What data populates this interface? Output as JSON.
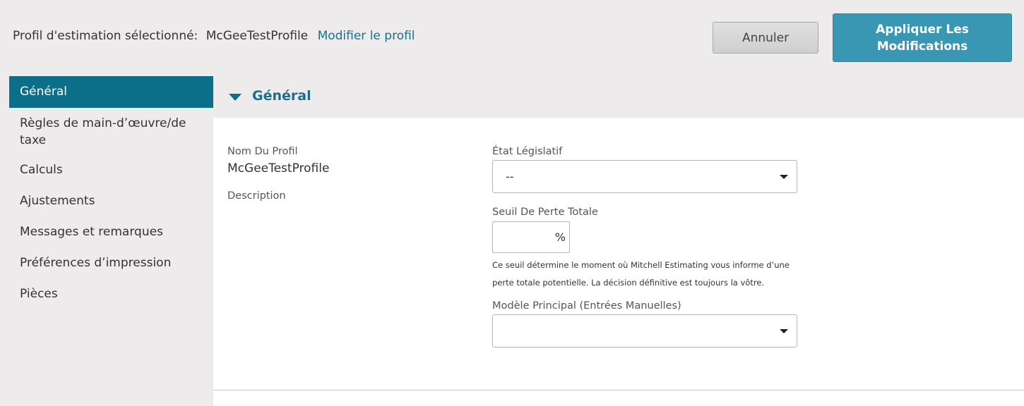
{
  "header": {
    "label": "Profil d'estimation sélectionné:",
    "profile_name": "McGeeTestProfile",
    "edit_link": "Modifier le profil",
    "cancel_label": "Annuler",
    "apply_label": "Appliquer Les Modifications"
  },
  "sidebar": {
    "items": [
      {
        "label": "Général",
        "active": true
      },
      {
        "label": "Règles de main-d’œuvre/de taxe"
      },
      {
        "label": "Calculs"
      },
      {
        "label": "Ajustements"
      },
      {
        "label": "Messages et remarques"
      },
      {
        "label": "Préférences d’impression"
      },
      {
        "label": "Pièces"
      }
    ]
  },
  "section": {
    "title": "Général"
  },
  "form": {
    "profile_name_label": "Nom Du Profil",
    "profile_name_value": "McGeeTestProfile",
    "description_label": "Description",
    "state_label": "État Législatif",
    "state_value": "--",
    "threshold_label": "Seuil De Perte Totale",
    "threshold_value": "",
    "threshold_unit": "%",
    "threshold_help": "Ce seuil détermine le moment où Mitchell Estimating vous informe d’une perte totale potentielle. La décision définitive est toujours la vôtre.",
    "model_label": "Modèle Principal (Entrées Manuelles)",
    "model_value": ""
  },
  "colors": {
    "accent": "#0c6f8a",
    "apply_button": "#3a97b3",
    "link": "#1c6f8c",
    "background": "#edebeb"
  },
  "icons": {
    "section_toggle": "caret-down-icon",
    "dropdown": "chevron-down-icon"
  }
}
